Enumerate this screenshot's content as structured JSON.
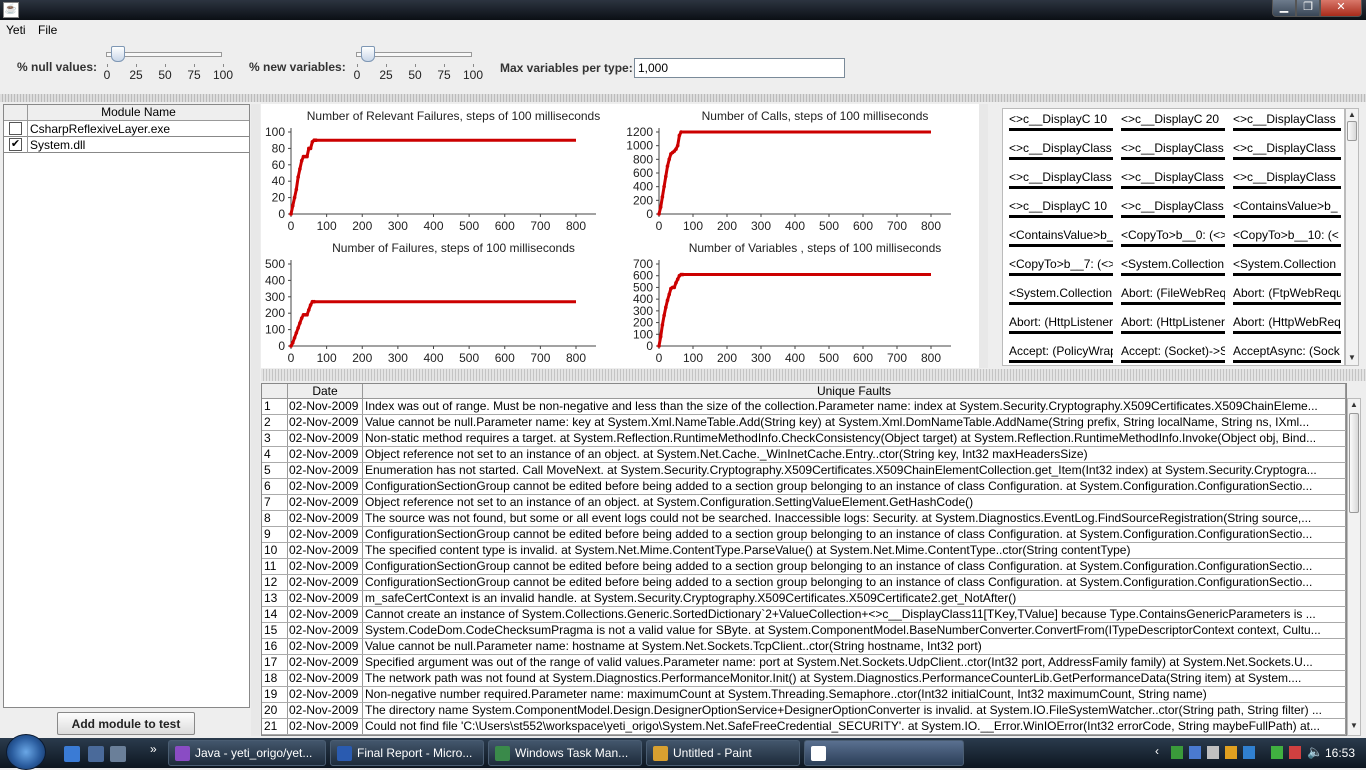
{
  "window": {
    "title": "",
    "minimize": "▁",
    "maximize": "❐",
    "close": "✕"
  },
  "menu": {
    "yeti": "Yeti",
    "file": "File"
  },
  "toolbar": {
    "null_label": "% null values:",
    "null_value": 10,
    "newvar_label": "% new variables:",
    "newvar_value": 10,
    "slider_ticks": [
      "0",
      "25",
      "50",
      "75",
      "100"
    ],
    "maxvars_label": "Max variables per type:",
    "maxvars_value": "1,000"
  },
  "modules": {
    "header": "Module Name",
    "items": [
      {
        "name": "CsharpReflexiveLayer.exe",
        "checked": false
      },
      {
        "name": "System.dll",
        "checked": true
      }
    ],
    "add_button": "Add module to test"
  },
  "charts": {
    "line_color": "#cc0000"
  },
  "chart_data": [
    {
      "type": "line",
      "title": "Number of Relevant Failures, steps of 100 milliseconds",
      "x": [
        0,
        5,
        10,
        15,
        20,
        25,
        30,
        35,
        40,
        45,
        50,
        55,
        60,
        65,
        70,
        800
      ],
      "y": [
        0,
        10,
        20,
        30,
        45,
        55,
        65,
        70,
        70,
        70,
        80,
        80,
        88,
        90,
        90,
        90
      ],
      "xlim": [
        0,
        800
      ],
      "ylim": [
        0,
        100
      ],
      "xticks": [
        "0",
        "100",
        "200",
        "300",
        "400",
        "500",
        "600",
        "700",
        "800"
      ],
      "yticks": [
        "0",
        "20",
        "40",
        "60",
        "80",
        "100"
      ]
    },
    {
      "type": "line",
      "title": "Number of Calls, steps of 100 milliseconds",
      "x": [
        0,
        5,
        10,
        15,
        20,
        25,
        30,
        35,
        40,
        45,
        50,
        55,
        60,
        65,
        800
      ],
      "y": [
        0,
        100,
        250,
        400,
        550,
        700,
        800,
        880,
        900,
        920,
        950,
        1000,
        1150,
        1200,
        1200
      ],
      "xlim": [
        0,
        800
      ],
      "ylim": [
        0,
        1200
      ],
      "xticks": [
        "0",
        "100",
        "200",
        "300",
        "400",
        "500",
        "600",
        "700",
        "800"
      ],
      "yticks": [
        "0",
        "200",
        "400",
        "600",
        "800",
        "1000",
        "1200"
      ]
    },
    {
      "type": "line",
      "title": "Number of Failures, steps of 100 milliseconds",
      "x": [
        0,
        5,
        10,
        15,
        20,
        25,
        30,
        35,
        40,
        45,
        50,
        55,
        60,
        65,
        800
      ],
      "y": [
        0,
        20,
        50,
        80,
        110,
        140,
        170,
        190,
        190,
        190,
        220,
        250,
        270,
        270,
        270
      ],
      "xlim": [
        0,
        800
      ],
      "ylim": [
        0,
        500
      ],
      "xticks": [
        "0",
        "100",
        "200",
        "300",
        "400",
        "500",
        "600",
        "700",
        "800"
      ],
      "yticks": [
        "0",
        "100",
        "200",
        "300",
        "400",
        "500"
      ]
    },
    {
      "type": "line",
      "title": "Number of Variables , steps of 100 milliseconds",
      "x": [
        0,
        5,
        10,
        15,
        20,
        25,
        30,
        35,
        40,
        45,
        50,
        55,
        60,
        65,
        70,
        800
      ],
      "y": [
        0,
        80,
        180,
        260,
        330,
        390,
        440,
        490,
        500,
        500,
        540,
        570,
        600,
        610,
        610,
        610
      ],
      "xlim": [
        0,
        800
      ],
      "ylim": [
        0,
        700
      ],
      "xticks": [
        "0",
        "100",
        "200",
        "300",
        "400",
        "500",
        "600",
        "700",
        "800"
      ],
      "yticks": [
        "0",
        "100",
        "200",
        "300",
        "400",
        "500",
        "600",
        "700"
      ]
    }
  ],
  "variables": [
    "<>c__DisplayC 10",
    "<>c__DisplayC 20",
    "<>c__DisplayClass",
    "<>c__DisplayClass",
    "<>c__DisplayClass",
    "<>c__DisplayClass",
    "<>c__DisplayClass",
    "<>c__DisplayClass",
    "<>c__DisplayClass",
    "<>c__DisplayC 10",
    "<>c__DisplayClass",
    "<ContainsValue>b_",
    "<ContainsValue>b_",
    "<CopyTo>b__0: (<>",
    "<CopyTo>b__10: (<",
    "<CopyTo>b__7: (<>",
    "<System.Collection",
    "<System.Collection",
    "<System.Collection",
    "Abort: (FileWebReq",
    "Abort: (FtpWebRequ",
    "Abort: (HttpListener)",
    "Abort: (HttpListenerl",
    "Abort: (HttpWebReq",
    "Accept: (PolicyWrap",
    "Accept: (Socket)->S",
    "AcceptAsync: (Sock"
  ],
  "faults": {
    "headers": [
      "",
      "Date",
      "Unique Faults"
    ],
    "rows": [
      [
        "1",
        "02-Nov-2009",
        "Index was out of range. Must be non-negative and less than the size of the collection.Parameter name: index   at System.Security.Cryptography.X509Certificates.X509ChainEleme..."
      ],
      [
        "2",
        "02-Nov-2009",
        "Value cannot be null.Parameter name: key   at System.Xml.NameTable.Add(String key)   at System.Xml.DomNameTable.AddName(String prefix, String localName, String ns, IXml..."
      ],
      [
        "3",
        "02-Nov-2009",
        "Non-static method requires a target.   at System.Reflection.RuntimeMethodInfo.CheckConsistency(Object target)   at System.Reflection.RuntimeMethodInfo.Invoke(Object obj, Bind..."
      ],
      [
        "4",
        "02-Nov-2009",
        "Object reference not set to an instance of an object.   at System.Net.Cache._WinInetCache.Entry..ctor(String key, Int32 maxHeadersSize)"
      ],
      [
        "5",
        "02-Nov-2009",
        "Enumeration has not started.  Call MoveNext.   at System.Security.Cryptography.X509Certificates.X509ChainElementCollection.get_Item(Int32 index)   at System.Security.Cryptogra..."
      ],
      [
        "6",
        "02-Nov-2009",
        "ConfigurationSectionGroup cannot be edited before being added to a section group belonging to an instance of class Configuration.   at System.Configuration.ConfigurationSectio..."
      ],
      [
        "7",
        "02-Nov-2009",
        "Object reference not set to an instance of an object.   at System.Configuration.SettingValueElement.GetHashCode()"
      ],
      [
        "8",
        "02-Nov-2009",
        "The source was not found, but some or all event logs could not be searched.  Inaccessible logs: Security.   at System.Diagnostics.EventLog.FindSourceRegistration(String source,..."
      ],
      [
        "9",
        "02-Nov-2009",
        "ConfigurationSectionGroup cannot be edited before being added to a section group belonging to an instance of class Configuration.   at System.Configuration.ConfigurationSectio..."
      ],
      [
        "10",
        "02-Nov-2009",
        "The specified content type is invalid.   at System.Net.Mime.ContentType.ParseValue()   at System.Net.Mime.ContentType..ctor(String contentType)"
      ],
      [
        "11",
        "02-Nov-2009",
        "ConfigurationSectionGroup cannot be edited before being added to a section group belonging to an instance of class Configuration.   at System.Configuration.ConfigurationSectio..."
      ],
      [
        "12",
        "02-Nov-2009",
        "ConfigurationSectionGroup cannot be edited before being added to a section group belonging to an instance of class Configuration.   at System.Configuration.ConfigurationSectio..."
      ],
      [
        "13",
        "02-Nov-2009",
        "m_safeCertContext is an invalid handle.   at System.Security.Cryptography.X509Certificates.X509Certificate2.get_NotAfter()"
      ],
      [
        "14",
        "02-Nov-2009",
        "Cannot create an instance of System.Collections.Generic.SortedDictionary`2+ValueCollection+<>c__DisplayClass11[TKey,TValue] because Type.ContainsGenericParameters is ..."
      ],
      [
        "15",
        "02-Nov-2009",
        "System.CodeDom.CodeChecksumPragma is not a valid value for SByte.   at System.ComponentModel.BaseNumberConverter.ConvertFrom(ITypeDescriptorContext context, Cultu..."
      ],
      [
        "16",
        "02-Nov-2009",
        "Value cannot be null.Parameter name: hostname   at System.Net.Sockets.TcpClient..ctor(String hostname, Int32 port)"
      ],
      [
        "17",
        "02-Nov-2009",
        "Specified argument was out of the range of valid values.Parameter name: port   at System.Net.Sockets.UdpClient..ctor(Int32 port, AddressFamily family)   at System.Net.Sockets.U..."
      ],
      [
        "18",
        "02-Nov-2009",
        "The network path was not found   at System.Diagnostics.PerformanceMonitor.Init()   at System.Diagnostics.PerformanceCounterLib.GetPerformanceData(String item)   at System...."
      ],
      [
        "19",
        "02-Nov-2009",
        "Non-negative number required.Parameter name: maximumCount   at System.Threading.Semaphore..ctor(Int32 initialCount, Int32 maximumCount, String name)"
      ],
      [
        "20",
        "02-Nov-2009",
        "The directory name System.ComponentModel.Design.DesignerOptionService+DesignerOptionConverter is invalid.   at System.IO.FileSystemWatcher..ctor(String path, String filter) ..."
      ],
      [
        "21",
        "02-Nov-2009",
        "Could not find file 'C:\\Users\\st552\\workspace\\yeti_origo\\System.Net.SafeFreeCredential_SECURITY'.   at System.IO.__Error.WinIOError(Int32 errorCode, String maybeFullPath)   at..."
      ]
    ]
  },
  "taskbar": {
    "tasks": [
      "Java - yeti_origo/yet...",
      "Final Report - Micro...",
      "Windows Task Man...",
      "Untitled - Paint",
      ""
    ],
    "clock": "16:53",
    "quick_more": "»"
  }
}
